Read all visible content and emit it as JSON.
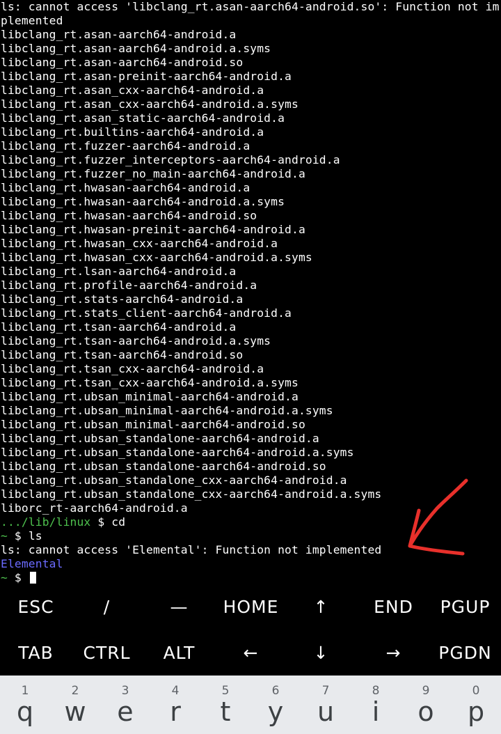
{
  "terminal": {
    "lines": [
      "ls: cannot access 'libclang_rt.asan-aarch64-android.so': Function not im",
      "plemented",
      "libclang_rt.asan-aarch64-android.a",
      "libclang_rt.asan-aarch64-android.a.syms",
      "libclang_rt.asan-aarch64-android.so",
      "libclang_rt.asan-preinit-aarch64-android.a",
      "libclang_rt.asan_cxx-aarch64-android.a",
      "libclang_rt.asan_cxx-aarch64-android.a.syms",
      "libclang_rt.asan_static-aarch64-android.a",
      "libclang_rt.builtins-aarch64-android.a",
      "libclang_rt.fuzzer-aarch64-android.a",
      "libclang_rt.fuzzer_interceptors-aarch64-android.a",
      "libclang_rt.fuzzer_no_main-aarch64-android.a",
      "libclang_rt.hwasan-aarch64-android.a",
      "libclang_rt.hwasan-aarch64-android.a.syms",
      "libclang_rt.hwasan-aarch64-android.so",
      "libclang_rt.hwasan-preinit-aarch64-android.a",
      "libclang_rt.hwasan_cxx-aarch64-android.a",
      "libclang_rt.hwasan_cxx-aarch64-android.a.syms",
      "libclang_rt.lsan-aarch64-android.a",
      "libclang_rt.profile-aarch64-android.a",
      "libclang_rt.stats-aarch64-android.a",
      "libclang_rt.stats_client-aarch64-android.a",
      "libclang_rt.tsan-aarch64-android.a",
      "libclang_rt.tsan-aarch64-android.a.syms",
      "libclang_rt.tsan-aarch64-android.so",
      "libclang_rt.tsan_cxx-aarch64-android.a",
      "libclang_rt.tsan_cxx-aarch64-android.a.syms",
      "libclang_rt.ubsan_minimal-aarch64-android.a",
      "libclang_rt.ubsan_minimal-aarch64-android.a.syms",
      "libclang_rt.ubsan_minimal-aarch64-android.so",
      "libclang_rt.ubsan_standalone-aarch64-android.a",
      "libclang_rt.ubsan_standalone-aarch64-android.a.syms",
      "libclang_rt.ubsan_standalone-aarch64-android.so",
      "libclang_rt.ubsan_standalone_cxx-aarch64-android.a",
      "libclang_rt.ubsan_standalone_cxx-aarch64-android.a.syms",
      "liborc_rt-aarch64-android.a"
    ],
    "prompt1": {
      "path": ".../lib/linux",
      "dollar": " $ ",
      "command": "cd"
    },
    "prompt2": {
      "path": "~",
      "dollar": " $ ",
      "command": "ls"
    },
    "error_line": "ls: cannot access 'Elemental': Function not implemented",
    "dir_entry": "Elemental",
    "prompt3": {
      "path": "~",
      "dollar": " $ "
    }
  },
  "colors": {
    "background": "#000000",
    "text": "#ffffff",
    "prompt_path": "#4ec24e",
    "directory": "#6b6bff",
    "annotation_arrow": "#e8302b",
    "keyboard_bg": "#e8eaed"
  },
  "annotation": {
    "icon": "red-arrow-icon"
  },
  "extra_keys": {
    "row1": [
      "ESC",
      "/",
      "—",
      "HOME",
      "↑",
      "END",
      "PGUP"
    ],
    "row2": [
      "TAB",
      "CTRL",
      "ALT",
      "←",
      "↓",
      "→",
      "PGDN"
    ]
  },
  "keyboard": {
    "numbers": [
      "1",
      "2",
      "3",
      "4",
      "5",
      "6",
      "7",
      "8",
      "9",
      "0"
    ],
    "letters": [
      "q",
      "w",
      "e",
      "r",
      "t",
      "y",
      "u",
      "i",
      "o",
      "p"
    ]
  }
}
